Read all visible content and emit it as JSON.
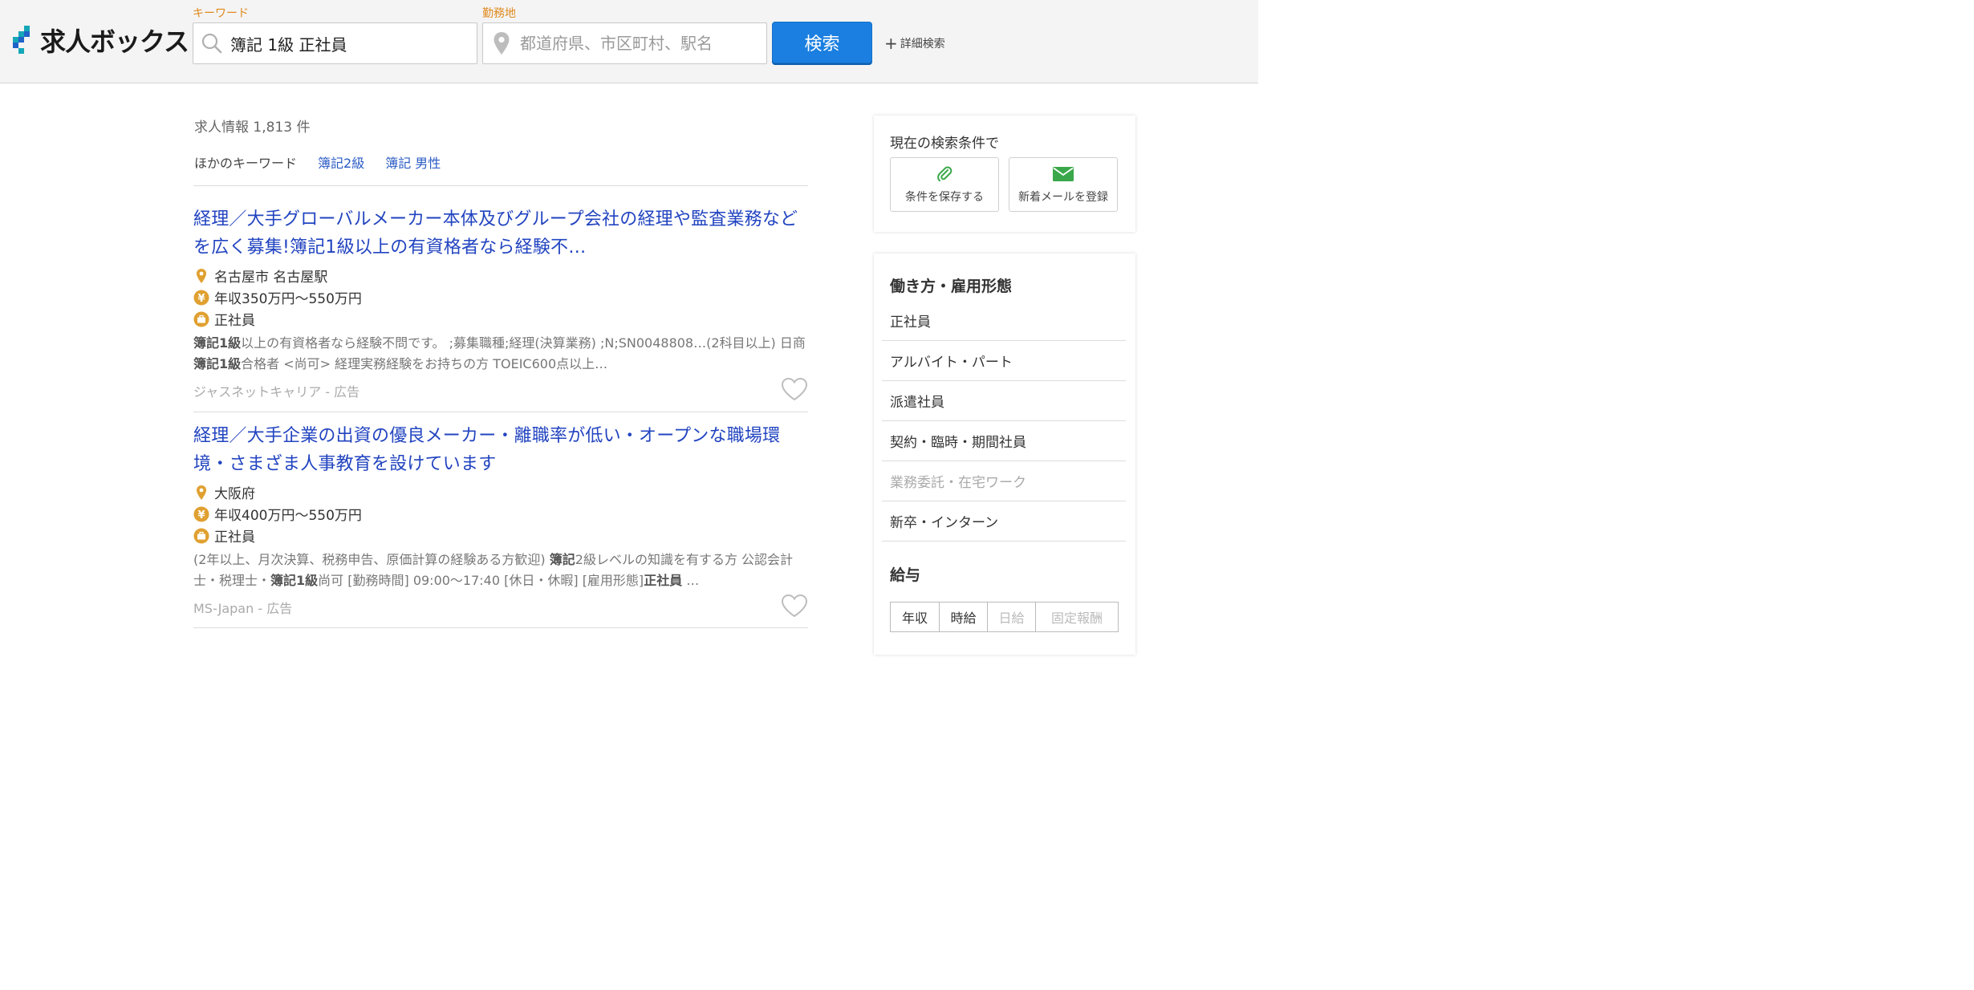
{
  "brand": {
    "name": "求人ボックス",
    "colors": {
      "accent": "#1a7fe0",
      "label": "#e08a1e",
      "link": "#2244c0",
      "logo_teal": "#14a7b8",
      "logo_blue": "#1f64c8"
    }
  },
  "search": {
    "keyword_label": "キーワード",
    "keyword_value": "簿記 1級 正社員",
    "location_label": "勤務地",
    "location_placeholder": "都道府県、市区町村、駅名",
    "submit_label": "検索",
    "advanced_label": "詳細検索"
  },
  "results": {
    "count_text": "求人情報 1,813 件",
    "other_keywords_label": "ほかのキーワード",
    "other_keywords": [
      "簿記2級",
      "簿記 男性"
    ],
    "jobs": [
      {
        "title": "経理／大手グローバルメーカー本体及びグループ会社の経理や監査業務などを広く募集!簿記1級以上の有資格者なら経験不…",
        "location": "名古屋市 名古屋駅",
        "salary": "年収350万円〜550万円",
        "employment": "正社員",
        "snippet": [
          {
            "t": "簿記1級",
            "b": true
          },
          {
            "t": "以上の有資格者なら経験不問です。 ;募集職種;経理(決算業務) ;N;SN0048808…(2科目以上) 日商",
            "b": false
          },
          {
            "t": "簿記1級",
            "b": true
          },
          {
            "t": "合格者 <尚可> 経理実務経験をお持ちの方 TOEIC600点以上…",
            "b": false
          }
        ],
        "source": "ジャスネットキャリア - 広告"
      },
      {
        "title": "経理／大手企業の出資の優良メーカー・離職率が低い・オープンな職場環境・さまざま人事教育を設けています",
        "location": "大阪府",
        "salary": "年収400万円〜550万円",
        "employment": "正社員",
        "snippet": [
          {
            "t": "(2年以上、月次決算、税務申告、原価計算の経験ある方歓迎) ",
            "b": false
          },
          {
            "t": "簿記",
            "b": true
          },
          {
            "t": "2級レベルの知識を有する方 公認会計士・税理士・",
            "b": false
          },
          {
            "t": "簿記1級",
            "b": true
          },
          {
            "t": "尚可 [勤務時間] 09:00〜17:40 [休日・休暇] [雇用形態]",
            "b": false
          },
          {
            "t": "正社員",
            "b": true
          },
          {
            "t": " …",
            "b": false
          }
        ],
        "source": "MS-Japan - 広告"
      }
    ]
  },
  "sidebar": {
    "conditions_title": "現在の検索条件で",
    "save_label": "条件を保存する",
    "mail_label": "新着メールを登録",
    "employment_title": "働き方・雇用形態",
    "employment_items": [
      {
        "label": "正社員",
        "enabled": true
      },
      {
        "label": "アルバイト・パート",
        "enabled": true
      },
      {
        "label": "派遣社員",
        "enabled": true
      },
      {
        "label": "契約・臨時・期間社員",
        "enabled": true
      },
      {
        "label": "業務委託・在宅ワーク",
        "enabled": false
      },
      {
        "label": "新卒・インターン",
        "enabled": true
      }
    ],
    "salary_title": "給与",
    "salary_tabs": [
      {
        "label": "年収",
        "enabled": true
      },
      {
        "label": "時給",
        "enabled": true
      },
      {
        "label": "日給",
        "enabled": false
      },
      {
        "label": "固定報酬",
        "enabled": false
      }
    ]
  }
}
